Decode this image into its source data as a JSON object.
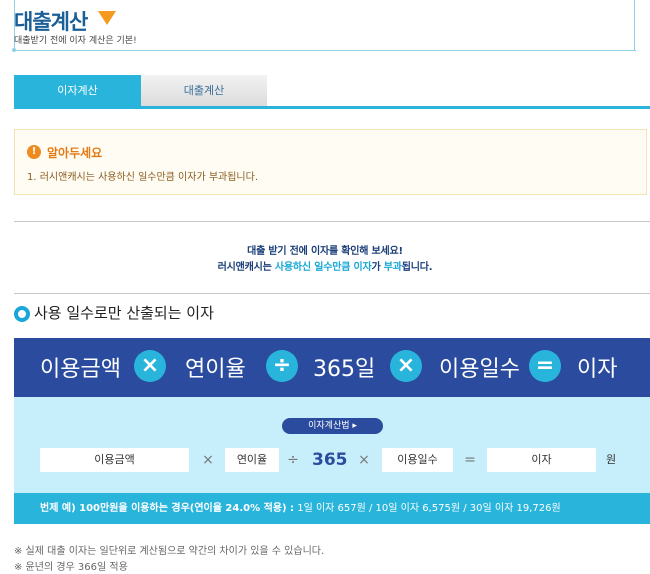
{
  "header": {
    "title": "대출계산",
    "subtitle": "대출받기 전에 이자 계산은 기본!"
  },
  "tabs": [
    {
      "label": "이자계산",
      "active": true
    },
    {
      "label": "대출계산",
      "active": false
    }
  ],
  "notice": {
    "icon": "exclamation-icon",
    "title": "알아두세요",
    "text": "1. 러시앤캐시는 사용하신 일수만큼 이자가 부과됩니다."
  },
  "intro": {
    "line1": "대출 받기 전에 이자를 확인해 보세요!",
    "line2_pre": "러시앤캐시는 ",
    "line2_hl1": "사용하신 일수만큼 이자",
    "line2_mid": "가 ",
    "line2_hl2": "부과",
    "line2_post": "됩니다."
  },
  "section": {
    "title": "사용 일수로만 산출되는 이자"
  },
  "formula": {
    "term1": "이용금액",
    "op1": "×",
    "term2": "연이율",
    "op2": "÷",
    "term3": "365일",
    "op3": "×",
    "term4": "이용일수",
    "op4": "=",
    "term5": "이자"
  },
  "calculator": {
    "button_label": "이자계산법 ▸",
    "amount_label": "이용금액",
    "times1": "×",
    "rate_label": "연이율",
    "divide": "÷",
    "days_year": "365",
    "times2": "×",
    "days_label": "이용일수",
    "equals": "=",
    "interest_label": "이자",
    "unit": "원"
  },
  "example": {
    "bold": "번제 예) 100만원을 이용하는 경우(연이율 24.0% 적용) :",
    "rest": " 1일 이자 657원 / 10일 이자 6,575원 / 30일 이자 19,726원"
  },
  "footnotes": [
    "※ 실제 대출 이자는 일단위로 계산됨으로 약간의 차이가 있을 수 있습니다.",
    "※ 윤년의 경우 366일 적용"
  ],
  "colors": {
    "accent": "#29b4dc",
    "navy": "#2b4c9e",
    "orange": "#f39a1f"
  }
}
